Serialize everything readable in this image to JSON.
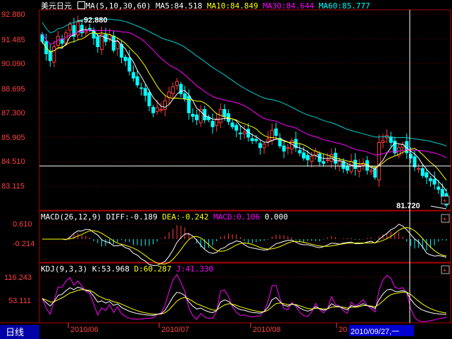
{
  "symbol": "美元日元",
  "ma_legend": {
    "params": "MA(5,10,30,60)",
    "ma5": "MA5:84.518",
    "ma10": "MA10:84.849",
    "ma30": "MA30:84.644",
    "ma60": "MA60:85.777"
  },
  "macd_legend": {
    "params": "MACD(26,12,9)",
    "diff": "DIFF:-0.189",
    "dea": "DEA:-0.242",
    "macd": "MACD:0.106",
    "extra": "0.000"
  },
  "kdj_legend": {
    "params": "KDJ(9,3,3)",
    "k": "K:53.968",
    "d": "D:60.287",
    "j": "J:41.330"
  },
  "price_axis": [
    "92.880",
    "91.485",
    "90.090",
    "88.695",
    "87.300",
    "85.905",
    "84.510",
    "83.115"
  ],
  "macd_axis": [
    "0.610",
    "-0.214"
  ],
  "kdj_axis": [
    "116.243",
    "53.111"
  ],
  "high_label": "92.880",
  "low_label": "81.720",
  "date_labels": [
    "2010/06",
    "2010/07",
    "2010/08",
    "20"
  ],
  "period_tab": "日线",
  "cursor_date": "2010/09/27,一",
  "colors": {
    "up": "#ff3c3c",
    "down": "#00ffff",
    "ma5": "#ffffff",
    "ma10": "#ffff00",
    "ma30": "#ff00ff",
    "ma60": "#00d0d0",
    "axis": "#b00000",
    "grid": "#800000"
  },
  "chart_data": {
    "type": "candlestick",
    "y_range": [
      81.72,
      92.88
    ],
    "x_ticks": [
      "2010/06",
      "2010/07",
      "2010/08"
    ],
    "closes": [
      91.3,
      90.6,
      90.2,
      91.0,
      91.6,
      91.2,
      91.8,
      92.3,
      91.6,
      92.4,
      91.8,
      91.9,
      92.0,
      91.5,
      91.0,
      91.7,
      91.3,
      91.7,
      90.8,
      91.3,
      90.4,
      90.2,
      89.6,
      89.2,
      88.8,
      88.6,
      88.2,
      87.6,
      87.2,
      87.5,
      87.4,
      87.9,
      88.4,
      88.7,
      89.0,
      88.3,
      88.0,
      87.2,
      87.0,
      86.8,
      87.4,
      86.8,
      86.8,
      86.4,
      86.8,
      87.4,
      87.0,
      86.7,
      86.4,
      86.2,
      86.0,
      86.1,
      85.8,
      85.6,
      85.6,
      85.2,
      85.4,
      85.7,
      86.2,
      85.9,
      85.3,
      85.0,
      85.2,
      85.6,
      85.2,
      84.9,
      84.6,
      84.5,
      84.7,
      85.0,
      84.4,
      84.3,
      84.5,
      84.8,
      84.3,
      84.4,
      84.0,
      83.9,
      84.4,
      84.0,
      84.2,
      84.3,
      83.9,
      83.9,
      83.5,
      85.5,
      85.6,
      85.9,
      85.5,
      84.9,
      85.2,
      85.4,
      84.9,
      84.6,
      84.1,
      84.0,
      83.6,
      83.5,
      83.3,
      83.1,
      82.8,
      82.4,
      81.9
    ],
    "macd_axis_range": [
      -1.0,
      0.8
    ],
    "kdj_axis_range": [
      0,
      120
    ]
  }
}
